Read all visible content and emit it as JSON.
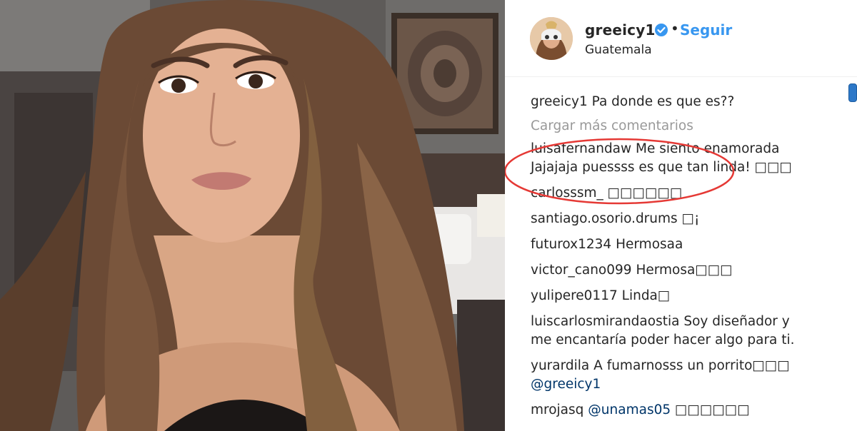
{
  "post": {
    "username": "greeicy1",
    "separator": "•",
    "follow_label": "Seguir",
    "location": "Guatemala"
  },
  "comments": {
    "caption": {
      "user": "greeicy1",
      "text": "Pa donde es que es??"
    },
    "load_more_label": "Cargar más comentarios",
    "items": [
      {
        "user": "luisafernandaw",
        "text": "Me siento enamorada",
        "text2": "Jajajaja puessss es que tan linda! □□□"
      },
      {
        "user": "carlosssm_",
        "text": "□□□□□□"
      },
      {
        "user": "santiago.osorio.drums",
        "text": "□¡"
      },
      {
        "user": "futurox1234",
        "text": "Hermosaa"
      },
      {
        "user": "victor_cano099",
        "text": "Hermosa□□□"
      },
      {
        "user": "yulipere0117",
        "text": "Linda□"
      },
      {
        "user": "luiscarlosmirandaostia",
        "text": "Soy diseñador y",
        "text2": "me encantaría poder hacer algo para ti."
      },
      {
        "user": "yurardila",
        "text": "A fumarnosss un porrito□□□",
        "text2": "@greeicy1"
      },
      {
        "user": "mrojasq",
        "text": "@unamas05",
        "text_tail": "□□□□□□"
      }
    ]
  },
  "colors": {
    "follow": "#3897f0",
    "load_more": "#999999",
    "highlight": "#e53935",
    "verified": "#3897f0"
  },
  "icons": {
    "verified": "verified-badge-icon"
  }
}
